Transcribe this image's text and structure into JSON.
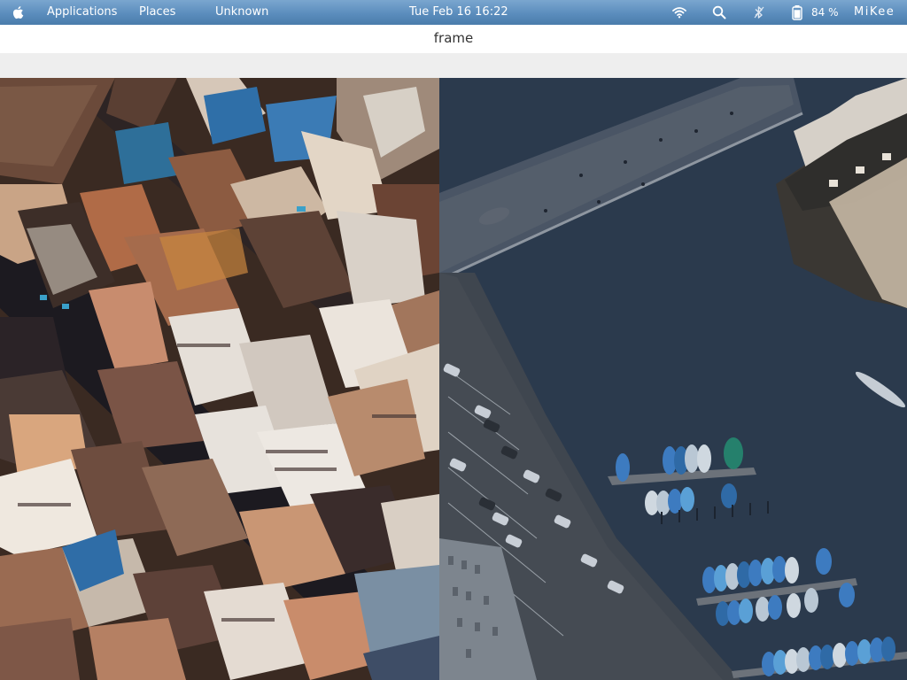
{
  "topbar": {
    "logo_icon": "apple-logo-icon",
    "menus": [
      "Applications",
      "Places",
      "Unknown"
    ],
    "clock": "Tue Feb 16  16:22",
    "status_icons": [
      "wifi-icon",
      "search-icon",
      "bluetooth-icon",
      "battery-icon"
    ],
    "battery_percent": "84 %",
    "battery_level": 0.84,
    "user": "MiKee"
  },
  "window": {
    "title": "frame"
  },
  "frame": {
    "left_view": "aerial-rooftops-photo",
    "right_view": "aerial-harbor-photo"
  },
  "colors": {
    "topbar": "#5b8dbd",
    "water": "#2b3a4d",
    "boat_blue": "#3d7bc0"
  }
}
